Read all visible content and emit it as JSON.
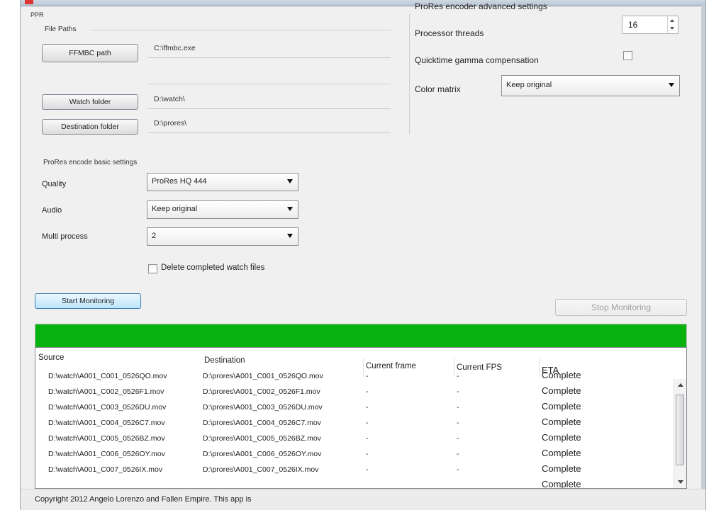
{
  "window": {
    "corner_label": "PPR"
  },
  "file_paths": {
    "group_label": "File Paths",
    "ffmbc_button": "FFMBC path",
    "ffmbc_value": "C:\\ffmbc.exe",
    "watch_button": "Watch folder",
    "watch_value": "D:\\watch\\",
    "dest_button": "Destination folder",
    "dest_value": "D:\\prores\\"
  },
  "basic_settings": {
    "group_label": "ProRes encode basic settings",
    "quality_label": "Quality",
    "quality_value": "ProRes HQ 444",
    "audio_label": "Audio",
    "audio_value": "Keep original",
    "multiprocess_label": "Multi process",
    "multiprocess_value": "2",
    "delete_label": "Delete completed watch files"
  },
  "advanced_settings": {
    "group_label": "ProRes encoder advanced settings",
    "threads_label": "Processor threads",
    "threads_value": "16",
    "gamma_label": "Quicktime gamma compensation",
    "color_label": "Color matrix",
    "color_value": "Keep original"
  },
  "actions": {
    "start": "Start Monitoring",
    "stop": "Stop Monitoring"
  },
  "progress": {
    "value": 1.0,
    "color": "#07b10e"
  },
  "table": {
    "columns": [
      "Source",
      "Destination",
      "Current frame",
      "Current FPS",
      "ETA"
    ],
    "rows": [
      {
        "source": "D:\\watch\\A001_C001_0526QO.mov",
        "destination": "D:\\prores\\A001_C001_0526QO.mov",
        "frame": "-",
        "fps": "-",
        "eta": "Complete"
      },
      {
        "source": "D:\\watch\\A001_C002_0526F1.mov",
        "destination": "D:\\prores\\A001_C002_0526F1.mov",
        "frame": "-",
        "fps": "-",
        "eta": "Complete"
      },
      {
        "source": "D:\\watch\\A001_C003_0526DU.mov",
        "destination": "D:\\prores\\A001_C003_0526DU.mov",
        "frame": "-",
        "fps": "-",
        "eta": "Complete"
      },
      {
        "source": "D:\\watch\\A001_C004_0526C7.mov",
        "destination": "D:\\prores\\A001_C004_0526C7.mov",
        "frame": "-",
        "fps": "-",
        "eta": "Complete"
      },
      {
        "source": "D:\\watch\\A001_C005_0526BZ.mov",
        "destination": "D:\\prores\\A001_C005_0526BZ.mov",
        "frame": "-",
        "fps": "-",
        "eta": "Complete"
      },
      {
        "source": "D:\\watch\\A001_C006_0526OY.mov",
        "destination": "D:\\prores\\A001_C006_0526OY.mov",
        "frame": "-",
        "fps": "-",
        "eta": "Complete"
      },
      {
        "source": "D:\\watch\\A001_C007_0526IX.mov",
        "destination": "D:\\prores\\A001_C007_0526IX.mov",
        "frame": "-",
        "fps": "-",
        "eta": "Complete"
      },
      {
        "source": "",
        "destination": "",
        "frame": "",
        "fps": "",
        "eta": "Complete"
      }
    ]
  },
  "status": {
    "text": "Copyright 2012 Angelo Lorenzo and Fallen Empire. This app is"
  }
}
